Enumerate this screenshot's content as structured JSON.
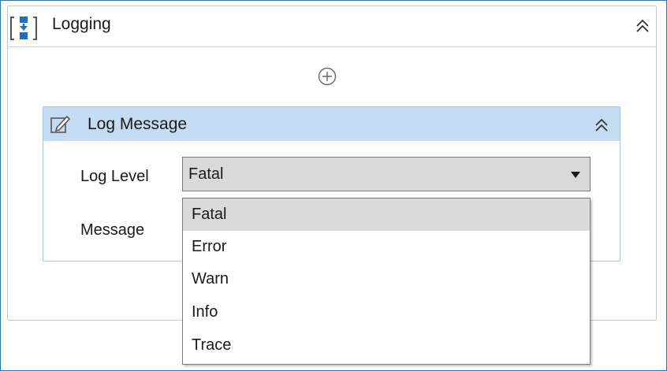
{
  "container": {
    "title": "Logging",
    "icon": "sequence-icon",
    "collapse_icon": "double-chevron-up-icon"
  },
  "add_icon": "plus-circle-icon",
  "activity": {
    "title": "Log Message",
    "icon": "log-message-icon",
    "collapse_icon": "double-chevron-up-icon",
    "log_level_label": "Log Level",
    "message_label": "Message",
    "log_level_value": "Fatal"
  },
  "dropdown": {
    "options": [
      "Fatal",
      "Error",
      "Warn",
      "Info",
      "Trace"
    ],
    "selected": "Fatal"
  },
  "colors": {
    "frame_border": "#2b73c9",
    "activity_header": "#c4dcf2",
    "icon_blue": "#1f6fc5",
    "selected_option": "#dadada"
  }
}
